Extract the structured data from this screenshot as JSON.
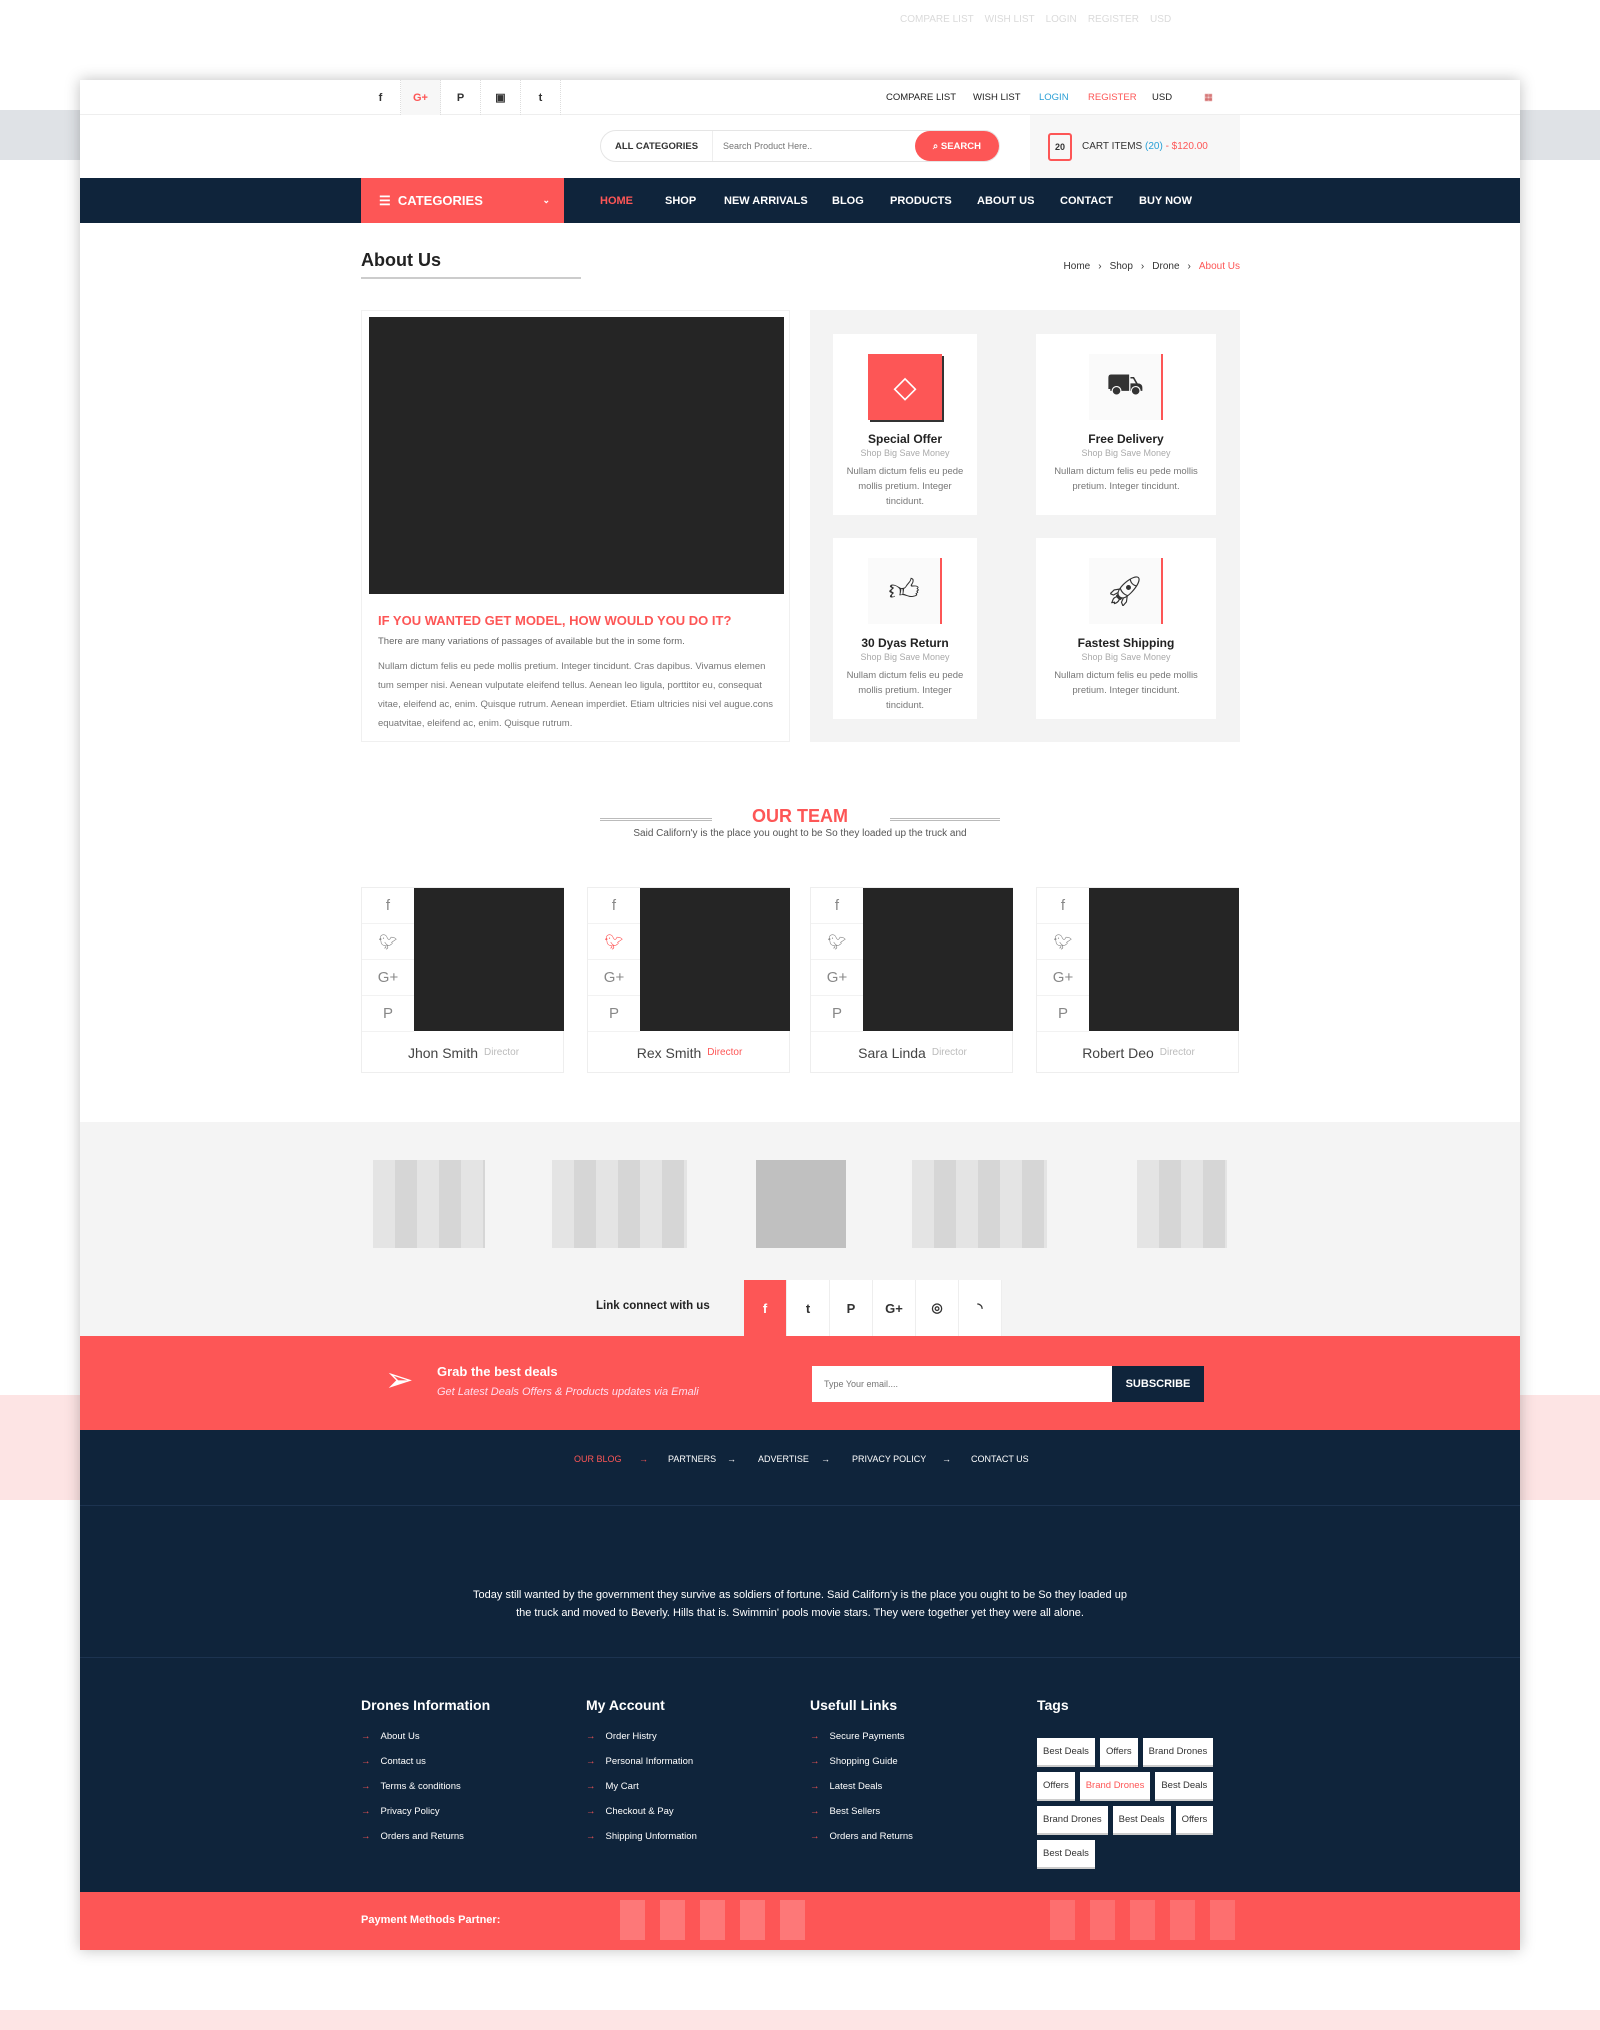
{
  "colors": {
    "accent": "#fd5656",
    "navy": "#0f243b",
    "link_blue": "#2a9fd6"
  },
  "topbar": {
    "social": [
      "f",
      "G+",
      "P",
      "▣",
      "t"
    ],
    "links": [
      "COMPARE LIST",
      "WISH LIST",
      "LOGIN",
      "REGISTER",
      "USD"
    ]
  },
  "header": {
    "category_select": "ALL CATEGORIES",
    "search_placeholder": "Search Product Here..",
    "search_button": "SEARCH",
    "cart_count": "20",
    "cart_label": "CART ITEMS",
    "cart_items": "(20)",
    "cart_total": "- $120.00"
  },
  "nav": {
    "categories": "CATEGORIES",
    "items": [
      "HOME",
      "SHOP",
      "NEW ARRIVALS",
      "BLOG",
      "PRODUCTS",
      "ABOUT US",
      "CONTACT",
      "BUY NOW"
    ]
  },
  "page": {
    "title": "About Us",
    "breadcrumb": [
      "Home",
      "Shop",
      "Drone",
      "About Us"
    ]
  },
  "about": {
    "heading": "IF YOU WANTED GET MODEL, HOW WOULD YOU DO IT?",
    "lead": "There are many variations of passages of available but the in some form.",
    "body": "Nullam dictum felis eu pede mollis pretium. Integer tincidunt. Cras dapibus. Vivamus elemen tum semper nisi. Aenean vulputate eleifend tellus. Aenean leo ligula, porttitor eu, consequat vitae, eleifend ac, enim. Quisque rutrum. Aenean imperdiet. Etiam ultricies nisi vel augue.cons equatvitae, eleifend ac, enim. Quisque rutrum."
  },
  "features": [
    {
      "icon": "diamond-icon",
      "glyph": "◇",
      "title": "Special Offer",
      "sub": "Shop Big Save Money",
      "text": "Nullam dictum felis eu pede mollis pretium. Integer tincidunt."
    },
    {
      "icon": "truck-icon",
      "glyph": "⛟",
      "title": "Free Delivery",
      "sub": "Shop Big Save Money",
      "text": "Nullam dictum felis eu pede mollis pretium. Integer tincidunt."
    },
    {
      "icon": "thumbs-up-icon",
      "glyph": "👍︎",
      "title": "30 Dyas Return",
      "sub": "Shop Big Save Money",
      "text": "Nullam dictum felis eu pede mollis pretium. Integer tincidunt."
    },
    {
      "icon": "rocket-icon",
      "glyph": "🚀︎",
      "title": "Fastest Shipping",
      "sub": "Shop Big Save Money",
      "text": "Nullam dictum felis eu pede mollis pretium. Integer tincidunt."
    }
  ],
  "team": {
    "title": "OUR TEAM",
    "subtitle": "Said Californ'y is the place you ought to be So they loaded up the truck and",
    "members": [
      {
        "name": "Jhon Smith",
        "role": "Director"
      },
      {
        "name": "Rex Smith",
        "role": "Director"
      },
      {
        "name": "Sara Linda",
        "role": "Director"
      },
      {
        "name": "Robert Deo",
        "role": "Director"
      }
    ],
    "social": [
      "f",
      "🐦︎",
      "G+",
      "P"
    ]
  },
  "connect": {
    "label": "Link connect with us",
    "icons": [
      "f",
      "t",
      "P",
      "G+",
      "◎",
      "◝"
    ]
  },
  "newsletter": {
    "title": "Grab the best deals",
    "subtitle": "Get Latest Deals Offers & Products updates via Emali",
    "placeholder": "Type Your email....",
    "button": "SUBSCRIBE"
  },
  "footer": {
    "links": [
      "OUR BLOG",
      "PARTNERS",
      "ADVERTISE",
      "PRIVACY  POLICY",
      "CONTACT US"
    ],
    "about": "Today still wanted by the government they survive as soldiers of fortune. Said Californ'y is the place you ought to be So they loaded up the truck and moved to Beverly. Hills that is. Swimmin' pools movie stars. They were together yet they were all alone.",
    "columns": [
      {
        "title": "Drones  Information",
        "items": [
          "About Us",
          "Contact us",
          "Terms & conditions",
          "Privacy Policy",
          "Orders and Returns"
        ]
      },
      {
        "title": "My Account",
        "items": [
          "Order Histry",
          "Personal Information",
          "My Cart",
          "Checkout & Pay",
          "Shipping Unformation"
        ]
      },
      {
        "title": "Usefull Links",
        "items": [
          "Secure Payments",
          "Shopping Guide",
          "Latest Deals",
          "Best Sellers",
          "Orders and Returns"
        ]
      }
    ],
    "tags_title": "Tags",
    "tags": [
      "Best Deals",
      "Offers",
      "Brand Drones",
      "Offers",
      "Brand Drones",
      "Best Deals",
      "Brand Drones",
      "Best Deals",
      "Offers",
      "Best Deals"
    ],
    "payment": "Payment Methods Partner:"
  }
}
